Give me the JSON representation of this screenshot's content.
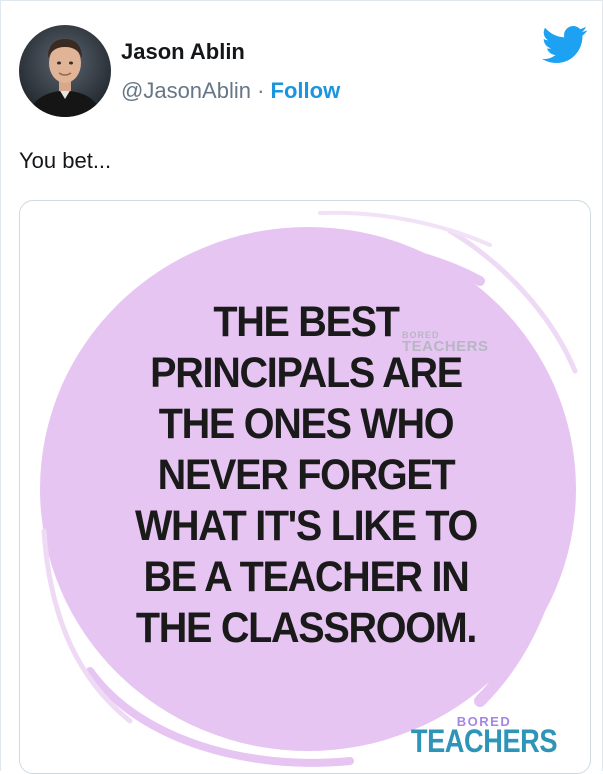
{
  "author": {
    "name": "Jason Ablin",
    "handle": "@JasonAblin",
    "separator": "·",
    "follow_label": "Follow"
  },
  "tweet": {
    "text": "You bet..."
  },
  "media": {
    "quote_lines": [
      "THE BEST",
      "PRINCIPALS ARE",
      "THE ONES WHO",
      "NEVER FORGET",
      "WHAT IT'S LIKE TO",
      "BE A TEACHER IN",
      "THE CLASSROOM."
    ],
    "watermark_small": "BORED",
    "watermark_big": "TEACHERS",
    "brand_small": "BORED",
    "brand_big": "TEACHERS"
  },
  "icons": {
    "logo": "twitter-bird-icon",
    "avatar": "avatar-photo"
  },
  "colors": {
    "follow": "#1b95e0",
    "twitter_blue": "#1da1f2",
    "circle": "#e6c5f2",
    "brand_purple": "#a585e8",
    "brand_blue": "#2e94b8"
  }
}
